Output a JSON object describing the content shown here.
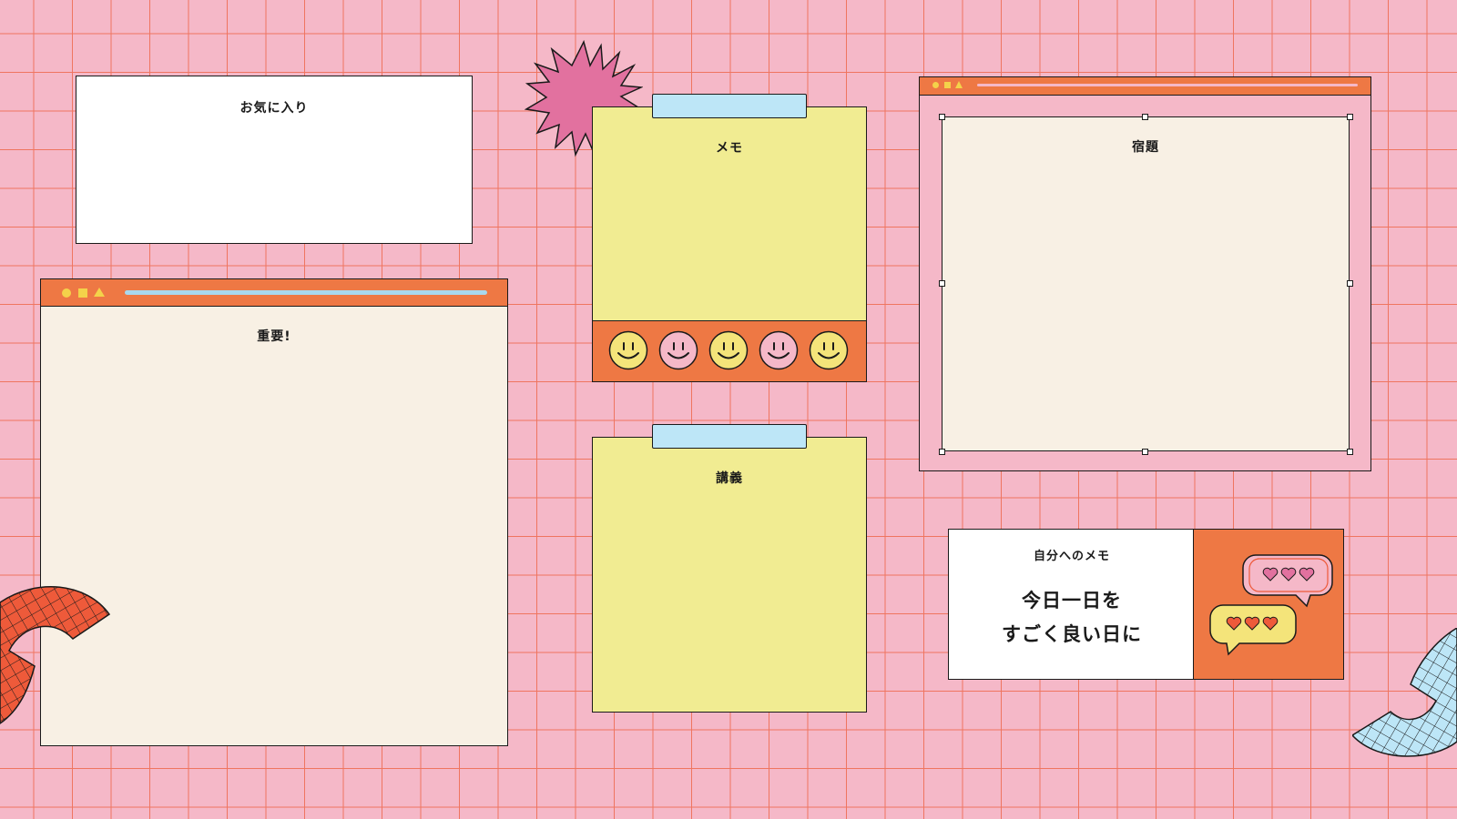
{
  "panels": {
    "favorites_title": "お気に入り",
    "important_title": "重要!",
    "memo_title": "メモ",
    "lecture_title": "講義",
    "homework_title": "宿題"
  },
  "self_memo": {
    "title": "自分へのメモ",
    "line1": "今日一日を",
    "line2": "すごく良い日に"
  },
  "colors": {
    "background": "#f5b8c8",
    "grid": "#ef7560",
    "accent_orange": "#ee7844",
    "note_yellow": "#f1ec92",
    "tape_blue": "#bde6f7",
    "paper": "#f8f0e4",
    "starburst": "#e2719f"
  },
  "icons": [
    "starburst-icon",
    "smiley-face-icon",
    "speech-bubble-hearts-icon",
    "checkered-arch-icon"
  ]
}
